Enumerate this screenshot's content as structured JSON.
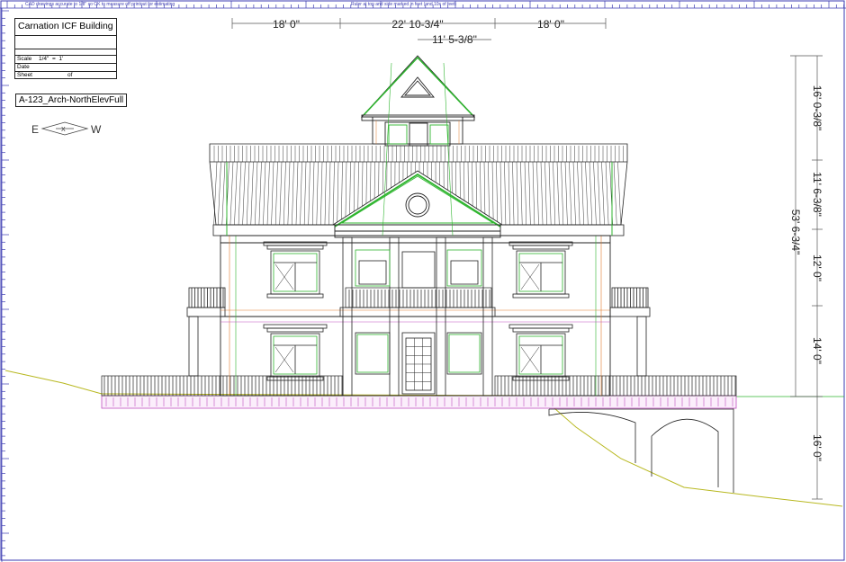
{
  "ruler_notes": {
    "top_left": "CAD drawings accurate to 1/8\" so OK to measure off printout for estimating",
    "top_right": "Ruler at top and side marked in feet (and 10s of feet)"
  },
  "title_block": {
    "project": "Carnation ICF Building",
    "scale_label": "Scale",
    "scale_value": "1/4\"  =  1'",
    "date_label": "Date",
    "sheet_label": "Sheet",
    "sheet_of": "of"
  },
  "drawing_id": "A-123_Arch-NorthElevFull",
  "orientation": {
    "left": "E",
    "mid": "X",
    "right": "W"
  },
  "dimensions": {
    "top": [
      "18' 0\"",
      "22' 10-3/4\"",
      "18' 0\""
    ],
    "top_sub": "11' 5-3/8\"",
    "right_overall": "53' 6-3/4\"",
    "right_levels": [
      "16' 0-3/8\"",
      "11' 6-3/8\"",
      "12' 0\"",
      "14' 0\"",
      "16' 0\""
    ]
  },
  "colors": {
    "line": "#222222",
    "frame": "#3a3ab0",
    "green": "#2fb52f",
    "orange": "#e07a2a",
    "magenta": "#c050c0",
    "ground": "#b8b820"
  }
}
